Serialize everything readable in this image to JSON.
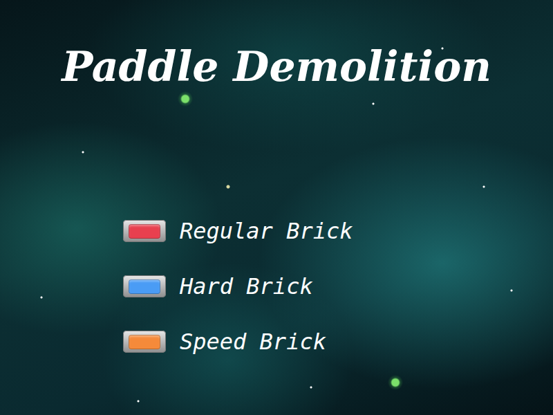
{
  "title": "Paddle Demolition",
  "legend": [
    {
      "label": "Regular Brick",
      "color": "#e8404f"
    },
    {
      "label": "Hard Brick",
      "color": "#4a9cf5"
    },
    {
      "label": "Speed Brick",
      "color": "#f58a3a"
    }
  ]
}
